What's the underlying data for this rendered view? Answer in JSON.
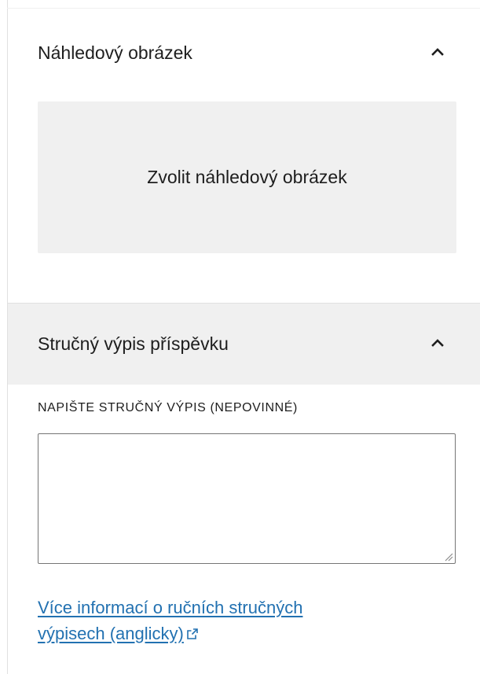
{
  "featured_image_panel": {
    "title": "Náhledový obrázek",
    "toggle_icon": "chevron-up-icon",
    "set_button_label": "Zvolit náhledový obrázek"
  },
  "excerpt_panel": {
    "title": "Stručný výpis příspěvku",
    "toggle_icon": "chevron-up-icon",
    "field_label": "NAPIŠTE STRUČNÝ VÝPIS (NEPOVINNÉ)",
    "field_value": "",
    "help_link_text_line1": "Více informací o ručních stručných",
    "help_link_text_line2": "výpisech (anglicky)",
    "help_link_icon": "external-link-icon"
  },
  "colors": {
    "link": "#2271b1",
    "panel_header_active_bg": "#f0f0f0",
    "button_bg": "#f0f0f0",
    "border": "#e0e0e0",
    "text": "#1e1e1e"
  }
}
